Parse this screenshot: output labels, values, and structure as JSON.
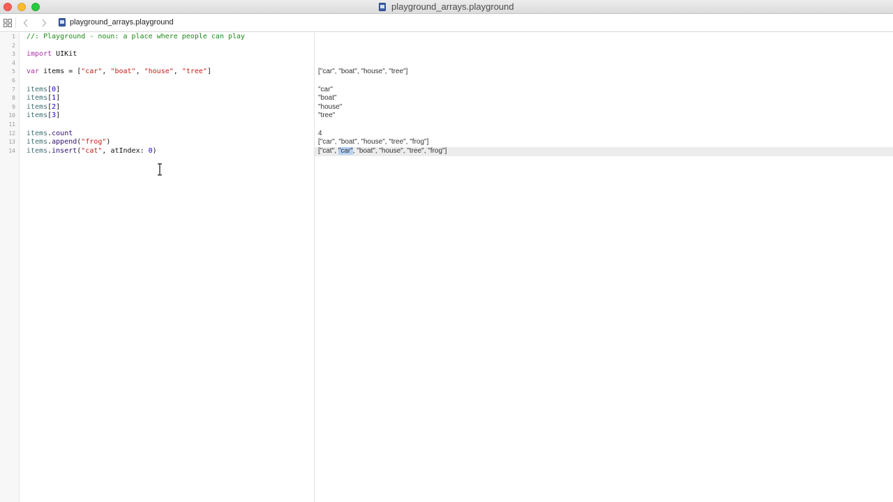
{
  "window": {
    "title": "playground_arrays.playground"
  },
  "jumpbar": {
    "file_name": "playground_arrays.playground"
  },
  "editor": {
    "line_numbers": [
      "1",
      "2",
      "3",
      "4",
      "5",
      "6",
      "7",
      "8",
      "9",
      "10",
      "11",
      "12",
      "13",
      "14"
    ],
    "lines": {
      "l1": {
        "comment": "//: Playground - noun: a place where people can play"
      },
      "l3": {
        "kw": "import",
        "rest": " UIKit"
      },
      "l5": {
        "kw": "var",
        "a": " items = [",
        "s1": "\"car\"",
        "c1": ", ",
        "s2": "\"boat\"",
        "c2": ", ",
        "s3": "\"house\"",
        "c3": ", ",
        "s4": "\"tree\"",
        "end": "]"
      },
      "l7": {
        "id": "items",
        "open": "[",
        "n": "0",
        "close": "]"
      },
      "l8": {
        "id": "items",
        "open": "[",
        "n": "1",
        "close": "]"
      },
      "l9": {
        "id": "items",
        "open": "[",
        "n": "2",
        "close": "]"
      },
      "l10": {
        "id": "items",
        "open": "[",
        "n": "3",
        "close": "]"
      },
      "l12": {
        "id": "items",
        "dot": ".",
        "m": "count"
      },
      "l13": {
        "id": "items",
        "dot": ".",
        "m": "append",
        "open": "(",
        "s": "\"frog\"",
        "close": ")"
      },
      "l14": {
        "id": "items",
        "dot": ".",
        "m": "insert",
        "open": "(",
        "s": "\"cat\"",
        "mid": ", atIndex: ",
        "n": "0",
        "close": ")"
      }
    }
  },
  "results": {
    "r5": "[\"car\", \"boat\", \"house\", \"tree\"]",
    "r7": "\"car\"",
    "r8": "\"boat\"",
    "r9": "\"house\"",
    "r10": "\"tree\"",
    "r12": "4",
    "r13": "[\"car\", \"boat\", \"house\", \"tree\", \"frog\"]",
    "r14": {
      "pre": "[\"cat\", ",
      "sel": "\"car\"",
      "post": ", \"boat\", \"house\", \"tree\", \"frog\"]"
    }
  },
  "icons": {
    "grid": "grid-icon",
    "back": "chevron-left-icon",
    "forward": "chevron-right-icon",
    "doc": "playground-file-icon",
    "cursor": "ibeam-cursor-icon"
  }
}
